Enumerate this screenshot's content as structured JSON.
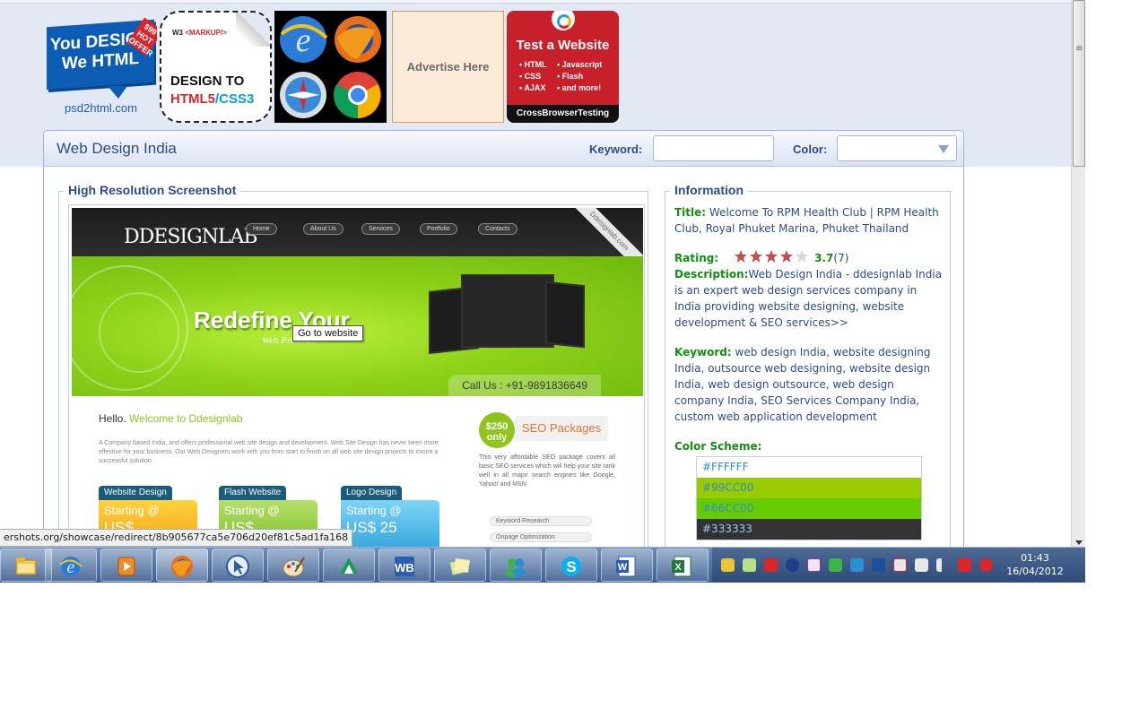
{
  "ads": {
    "psd": {
      "line1": "You DESIGN",
      "line2": "We HTML",
      "tag": "$99 HOT OFFER",
      "site": "psd2html.com"
    },
    "w3": {
      "brand_prefix": "W3",
      "brand_markup": "<MARKUP/>",
      "line1": "DESIGN TO",
      "line2": "HTML5",
      "line2b": "/CSS3"
    },
    "advertise": "Advertise Here",
    "crossbrowser": {
      "head": "Test a Website",
      "col1": [
        "HTML",
        "CSS",
        "AJAX"
      ],
      "col2": [
        "Javascript",
        "Flash",
        "and more!"
      ],
      "foot": "CrossBrowserTesting"
    }
  },
  "panel": {
    "title": "Web Design India",
    "keyword_label": "Keyword:",
    "keyword_value": "",
    "color_label": "Color:",
    "color_value": ""
  },
  "screenshot": {
    "legend": "High Resolution Screenshot",
    "site_logo": "DDESIGNLAB",
    "nav": [
      "Home",
      "About Us",
      "Services",
      "Portfolio",
      "Contacts"
    ],
    "ribbon": "Ddesignlab.com",
    "headline": "Redefine Your",
    "subline": "Web Presence",
    "call": "Call Us : +91-9891836649",
    "tooltip": "Go to website",
    "hello": "Hello.",
    "welcome": "Welcome to Ddesignlab",
    "paragraph": "A Company based India, and offers professional web site design and development. Web Site Design has never been more effective for your business. Our Web Designers work with you from start to finish on all web site design projects to insure a successful solution.",
    "cards": [
      {
        "tab": "Website Design",
        "line": "Starting @",
        "price": "US$"
      },
      {
        "tab": "Flash Website",
        "line": "Starting @",
        "price": "US$"
      },
      {
        "tab": "Logo Design",
        "line": "Starting @",
        "price": "US$ 25"
      }
    ],
    "seo_badge": "$250 only",
    "seo_label": "SEO Packages",
    "seo_text": "This very affordable SEO package covers all basic SEO services which will help your site rank well in all major search engines like Google, Yahoo! and MSN",
    "pills": [
      "Keyword Research",
      "Onpage Optimization"
    ]
  },
  "info": {
    "legend": "Information",
    "title_label": "Title:",
    "title_value": "Welcome To RPM Health Club | RPM Health Club, Royal Phuket Marina, Phuket Thailand",
    "rating_label": "Rating:",
    "rating_value": "3.7",
    "rating_count": "(7)",
    "rating_stars": 3.7,
    "desc_label": "Description:",
    "desc_value": "Web Design India - ddesignlab India is an expert web design services company in India providing website designing, website development & SEO services>>",
    "keyword_label": "Keyword:",
    "keyword_value": "web design India, website designing India, outsource web designing, website design India, web design outsource, web design company India, SEO Services Company India, custom web application development",
    "scheme_label": "Color Scheme:",
    "colors": [
      {
        "hex": "#FFFFFF",
        "bg": "#FFFFFF"
      },
      {
        "hex": "#99CC00",
        "bg": "#99CC00"
      },
      {
        "hex": "#66CC00",
        "bg": "#66CC00"
      },
      {
        "hex": "#333333",
        "bg": "#333333"
      }
    ]
  },
  "status_url": "ershots.org/showcase/redirect/8b905677ca5e706d20ef81c5ad1fa168",
  "taskbar": {
    "apps": [
      "file-explorer-icon",
      "internet-explorer-icon",
      "media-player-icon",
      "firefox-icon",
      "cursor-app-icon",
      "paint-icon",
      "green-app-icon",
      "word-wb-icon",
      "notes-icon",
      "messenger-icon",
      "skype-icon",
      "word-icon",
      "excel-icon"
    ],
    "time": "01:43",
    "date": "16/04/2012"
  }
}
